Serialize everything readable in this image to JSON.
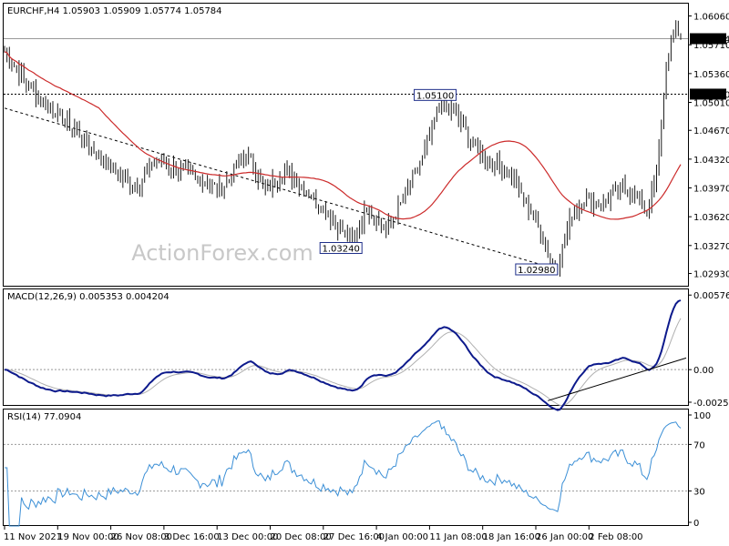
{
  "chart_data": [
    {
      "type": "candlestick",
      "title": "EURCHF,H4  1.05903 1.05909 1.05774 1.05784",
      "watermark": "ActionForex.com",
      "ylim": [
        1.0277,
        1.0621
      ],
      "y_ticks": [
        1.0606,
        1.0571,
        1.0536,
        1.0501,
        1.0467,
        1.0432,
        1.0397,
        1.0362,
        1.0327,
        1.0293
      ],
      "y_tick_labels": [
        "1.06060",
        "1.05710",
        "1.05360",
        "1.05010",
        "1.04670",
        "1.04320",
        "1.03970",
        "1.03620",
        "1.03270",
        "1.02930"
      ],
      "price_tags": [
        {
          "label": "1.05784",
          "value": 1.05784
        },
        {
          "label": "1.05110",
          "value": 1.0511
        }
      ],
      "horizontal_levels": [
        1.05784,
        1.0511
      ],
      "annotations": [
        {
          "label": "1.05100",
          "value": 1.051
        },
        {
          "label": "1.03240",
          "value": 1.0324
        },
        {
          "label": "1.02980",
          "value": 1.0298
        }
      ],
      "moving_average_color": "#cc2b2b",
      "candle_color": "#1a1a1a",
      "price_anchors": [
        [
          0,
          1.0563
        ],
        [
          8,
          1.0528
        ],
        [
          15,
          1.0505
        ],
        [
          22,
          1.0487
        ],
        [
          30,
          1.0465
        ],
        [
          38,
          1.0438
        ],
        [
          46,
          1.0415
        ],
        [
          55,
          1.0398
        ],
        [
          62,
          1.043
        ],
        [
          70,
          1.0423
        ],
        [
          78,
          1.041
        ],
        [
          90,
          1.0395
        ],
        [
          100,
          1.044
        ],
        [
          108,
          1.0395
        ],
        [
          116,
          1.0418
        ],
        [
          124,
          1.0398
        ],
        [
          132,
          1.0372
        ],
        [
          140,
          1.0345
        ],
        [
          144,
          1.0328
        ],
        [
          150,
          1.0375
        ],
        [
          158,
          1.0345
        ],
        [
          166,
          1.0388
        ],
        [
          174,
          1.044
        ],
        [
          180,
          1.05
        ],
        [
          186,
          1.0488
        ],
        [
          194,
          1.045
        ],
        [
          200,
          1.0432
        ],
        [
          208,
          1.042
        ],
        [
          216,
          1.038
        ],
        [
          222,
          1.0345
        ],
        [
          226,
          1.031
        ],
        [
          229,
          1.0302
        ],
        [
          235,
          1.0365
        ],
        [
          240,
          1.0383
        ],
        [
          248,
          1.0378
        ],
        [
          256,
          1.0398
        ],
        [
          262,
          1.0385
        ],
        [
          266,
          1.0368
        ],
        [
          270,
          1.041
        ],
        [
          274,
          1.0545
        ],
        [
          278,
          1.0592
        ],
        [
          280,
          1.0578
        ]
      ]
    },
    {
      "type": "line",
      "title": "MACD(12,26,9) 0.005353 0.004204",
      "ylim": [
        -0.0028,
        0.0062
      ],
      "y_ticks": [
        0.005761,
        0.0,
        -0.002546
      ],
      "y_tick_labels": [
        "0.005761",
        "0.00",
        "-0.002546"
      ],
      "series": [
        {
          "color": "#0d1a8c",
          "width": 2
        },
        {
          "color": "#b0b0b0",
          "width": 1
        }
      ],
      "trendline_color": "#000000"
    },
    {
      "type": "line",
      "title": "RSI(14) 77.0904",
      "ylim": [
        0,
        100
      ],
      "y_ticks": [
        100,
        70,
        30,
        0
      ],
      "y_tick_labels": [
        "100",
        "70",
        "30",
        "0"
      ],
      "levels": [
        70,
        30
      ],
      "series": [
        {
          "color": "#3b8fd6",
          "width": 1
        }
      ]
    }
  ],
  "x_axis": {
    "labels": [
      "11 Nov 2021",
      "19 Nov 00:00",
      "26 Nov 08:00",
      "3 Dec 16:00",
      "13 Dec 00:00",
      "20 Dec 08:00",
      "27 Dec 16:00",
      "4 Jan 00:00",
      "11 Jan 08:00",
      "18 Jan 16:00",
      "26 Jan 00:00",
      "2 Feb 08:00"
    ],
    "label_bars": [
      0,
      22,
      44,
      66,
      88,
      110,
      132,
      154,
      176,
      198,
      220,
      242
    ]
  }
}
